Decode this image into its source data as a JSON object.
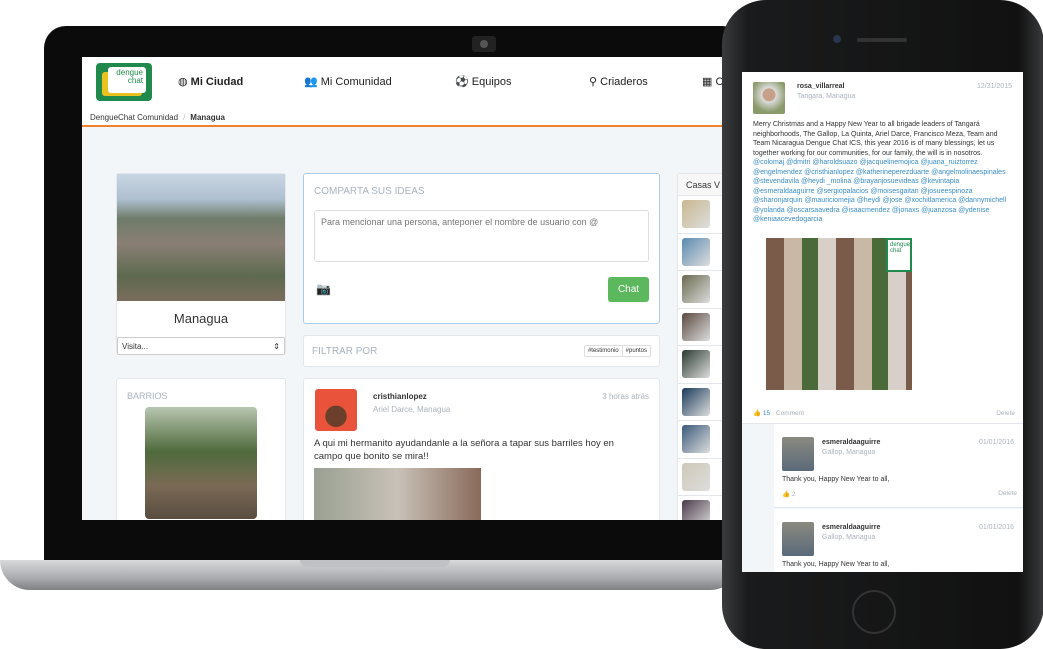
{
  "laptop": {
    "logo_text": "dengue chat",
    "nav": [
      {
        "label": "Mi Ciudad",
        "icon": "globe-icon",
        "active": true
      },
      {
        "label": "Mi Comunidad",
        "icon": "users-icon"
      },
      {
        "label": "Equipos",
        "icon": "soccer-ball-icon"
      },
      {
        "label": "Criaderos",
        "icon": "map-marker-icon"
      },
      {
        "label": "C",
        "icon": "table-icon"
      }
    ],
    "breadcrumb": [
      "DengueChat Comunidad",
      "Managua"
    ],
    "city": {
      "name": "Managua",
      "select_value": "Visita..."
    },
    "barrios_title": "BARRIOS",
    "share": {
      "title": "COMPARTA SUS IDEAS",
      "placeholder": "Para mencionar una persona, anteponer el nombre de usuario con @",
      "button": "Chat"
    },
    "filter": {
      "title": "FILTRAR POR",
      "tags": [
        "#testimonio",
        "#puntos"
      ]
    },
    "post": {
      "user": "cristhianlopez",
      "location": "Ariel Darce, Managua",
      "time": "3 horas atrás",
      "text": "A qui mi hermanito ayudandanle a la señora a tapar sus barriles hoy en campo que bonito se mira!!"
    },
    "side_title": "Casas V"
  },
  "phone": {
    "post": {
      "user": "rosa_villarreal",
      "location": "Tangara, Managua",
      "date": "12/31/2015",
      "text": "Merry Christmas and a Happy New Year to all brigade leaders of Tangará neighborhoods, The Gallop, La Quinta, Ariel Darce, Francisco Meza, Team and Team Nicaragua Dengue Chat ICS, this year 2016 is of many blessings, let us together working for our communities, for our family, the will is in nosotros.",
      "mentions": "@colomaj @dmitri @haroldsuazo @jacquelinemojica @juana_ruiztorrez @engelmendez @cristhianlopez @katherineperezduarte @angelmolinaespinales @stevendavila @heydi _molina @brayanjosuevideas @kevintapia @esmeraldaaguirre @sergiopalacios @moisesgaitan @josueespinoza @sharonjarquin @mauriciomejia @heydi @jose @xochitlamerica @dannymichell @yolanda @oscarsaavedra @isaacmendez @jonaxs @juanzosa @ydenise @keniaacevedogarcia",
      "likes": "15",
      "comment_label": "Comment",
      "delete_label": "Delete"
    },
    "comments": [
      {
        "user": "esmeraldaaguirre",
        "location": "Gallop, Managua",
        "date": "01/01/2016",
        "text": "Thank you, Happy New Year to all,",
        "likes": "2",
        "delete_label": "Delete"
      },
      {
        "user": "esmeraldaaguirre",
        "location": "Gallop, Managua",
        "date": "01/01/2016",
        "text": "Thank you, Happy New Year to all,"
      }
    ]
  },
  "colors": {
    "accent": "#f0812d",
    "chat_button": "#5cb85c",
    "link": "#3a8cc8",
    "background": "#f3f6f9"
  }
}
